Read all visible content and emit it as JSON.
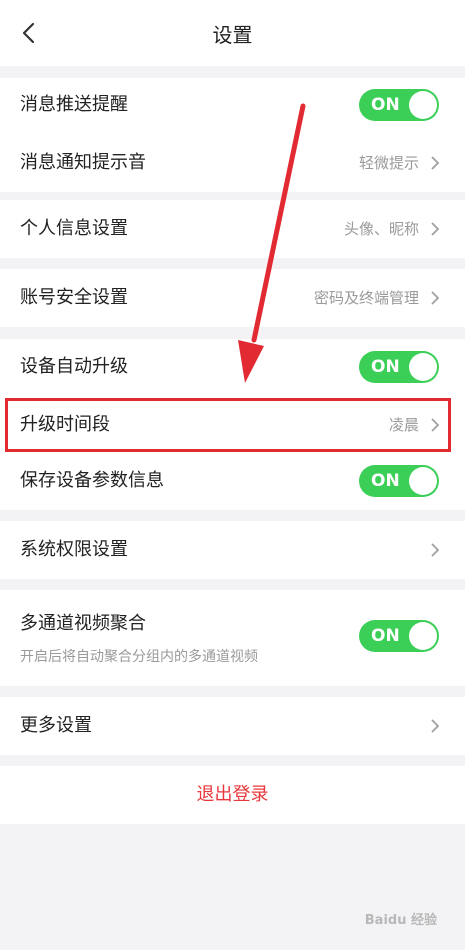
{
  "header": {
    "title": "设置",
    "back_icon": "chevron-left-icon"
  },
  "settings": {
    "push_reminder": {
      "label": "消息推送提醒",
      "toggle": "ON"
    },
    "notify_sound": {
      "label": "消息通知提示音",
      "value": "轻微提示"
    },
    "personal_info": {
      "label": "个人信息设置",
      "value": "头像、昵称"
    },
    "account_security": {
      "label": "账号安全设置",
      "value": "密码及终端管理"
    },
    "auto_upgrade": {
      "label": "设备自动升级",
      "toggle": "ON"
    },
    "upgrade_period": {
      "label": "升级时间段",
      "value": "凌晨"
    },
    "save_params": {
      "label": "保存设备参数信息",
      "toggle": "ON"
    },
    "permissions": {
      "label": "系统权限设置"
    },
    "multichannel": {
      "label": "多通道视频聚合",
      "sub": "开启后将自动聚合分组内的多通道视频",
      "toggle": "ON"
    },
    "more": {
      "label": "更多设置"
    }
  },
  "logout_label": "退出登录",
  "annotation_color": "#e22a33",
  "toggle_color": "#3ccf57",
  "watermark": "Baidu 经验"
}
